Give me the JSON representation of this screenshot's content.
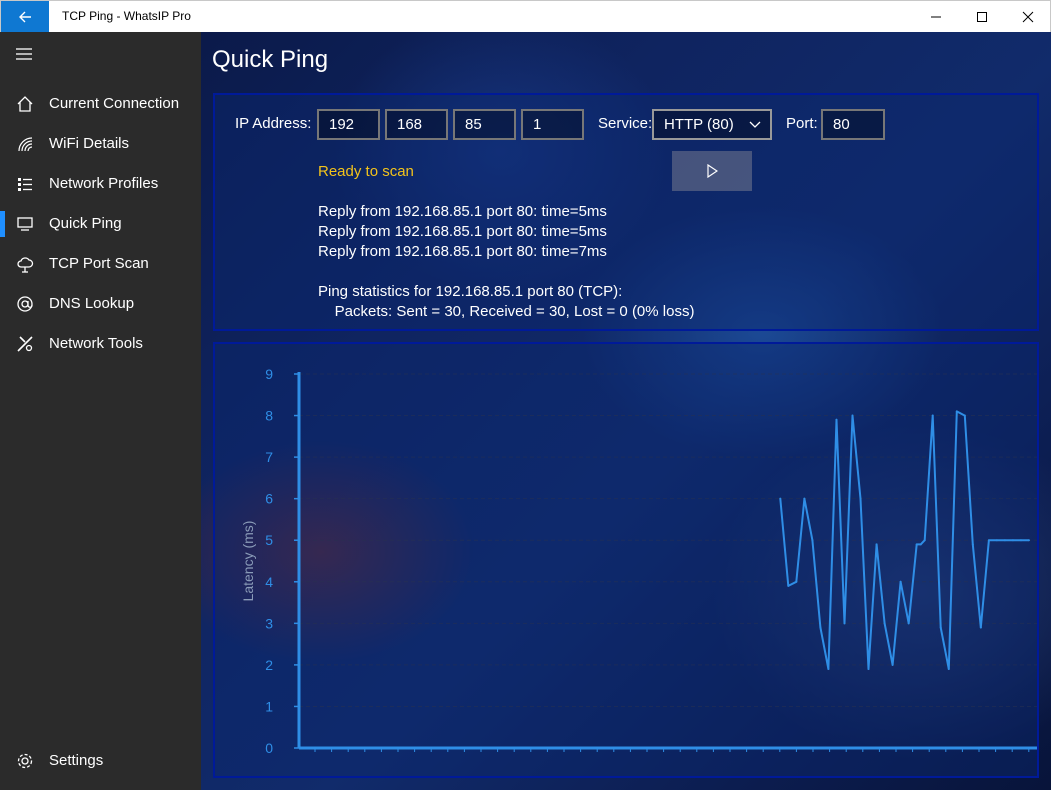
{
  "window": {
    "title": "TCP Ping - WhatsIP Pro",
    "back_icon": "back-arrow-icon",
    "minimize_icon": "minimize-icon",
    "maximize_icon": "maximize-icon",
    "close_icon": "close-icon"
  },
  "sidebar": {
    "menu_icon": "hamburger-menu-icon",
    "items": [
      {
        "label": "Current Connection",
        "icon": "home-icon",
        "selected": false
      },
      {
        "label": "WiFi Details",
        "icon": "wifi-icon",
        "selected": false
      },
      {
        "label": "Network Profiles",
        "icon": "list-icon",
        "selected": false
      },
      {
        "label": "Quick Ping",
        "icon": "monitor-icon",
        "selected": true
      },
      {
        "label": "TCP Port Scan",
        "icon": "cloud-icon",
        "selected": false
      },
      {
        "label": "DNS Lookup",
        "icon": "at-icon",
        "selected": false
      },
      {
        "label": "Network Tools",
        "icon": "tools-icon",
        "selected": false
      }
    ],
    "settings": {
      "label": "Settings",
      "icon": "gear-icon"
    }
  },
  "page": {
    "title": "Quick Ping"
  },
  "form": {
    "ip_label": "IP Address:",
    "ip_octets": [
      "192",
      "168",
      "85",
      "1"
    ],
    "service_label": "Service:",
    "service_value": "HTTP (80)",
    "port_label": "Port:",
    "port_value": "80",
    "play_icon": "play-icon",
    "status": "Ready to scan"
  },
  "results": {
    "lines": [
      "Reply from 192.168.85.1 port 80: time=5ms",
      "Reply from 192.168.85.1 port 80: time=5ms",
      "Reply from 192.168.85.1 port 80: time=7ms"
    ],
    "stats_header": "Ping statistics for 192.168.85.1 port 80 (TCP):",
    "stats_detail": "    Packets: Sent = 30, Received = 30, Lost = 0 (0% loss)"
  },
  "colors": {
    "accent": "#1f8fff",
    "status": "#f3c31b",
    "line": "#2f8ee6",
    "panel_border": "#001a99"
  },
  "chart_data": {
    "type": "line",
    "ylabel": "Latency (ms)",
    "ylim": [
      0,
      9
    ],
    "yticks": [
      0,
      1,
      2,
      3,
      4,
      5,
      6,
      7,
      8,
      9
    ],
    "grid": true,
    "x": [
      0,
      1,
      2,
      3,
      4,
      5,
      6,
      7,
      8,
      9,
      10,
      11,
      12,
      13,
      14,
      15,
      16,
      17,
      17.5,
      18,
      19,
      20,
      21,
      22,
      23,
      24,
      25,
      26,
      27,
      28,
      29,
      30,
      31
    ],
    "values": [
      6,
      3.9,
      4,
      6,
      5,
      2.9,
      1.9,
      7.9,
      3,
      8,
      6,
      1.9,
      4.9,
      3,
      2,
      4,
      3,
      4.9,
      4.9,
      5,
      8,
      2.9,
      1.9,
      8.1,
      8,
      4.9,
      2.9,
      5,
      5,
      5,
      5,
      5,
      5
    ],
    "x_visible_range": [
      -60,
      32
    ]
  }
}
